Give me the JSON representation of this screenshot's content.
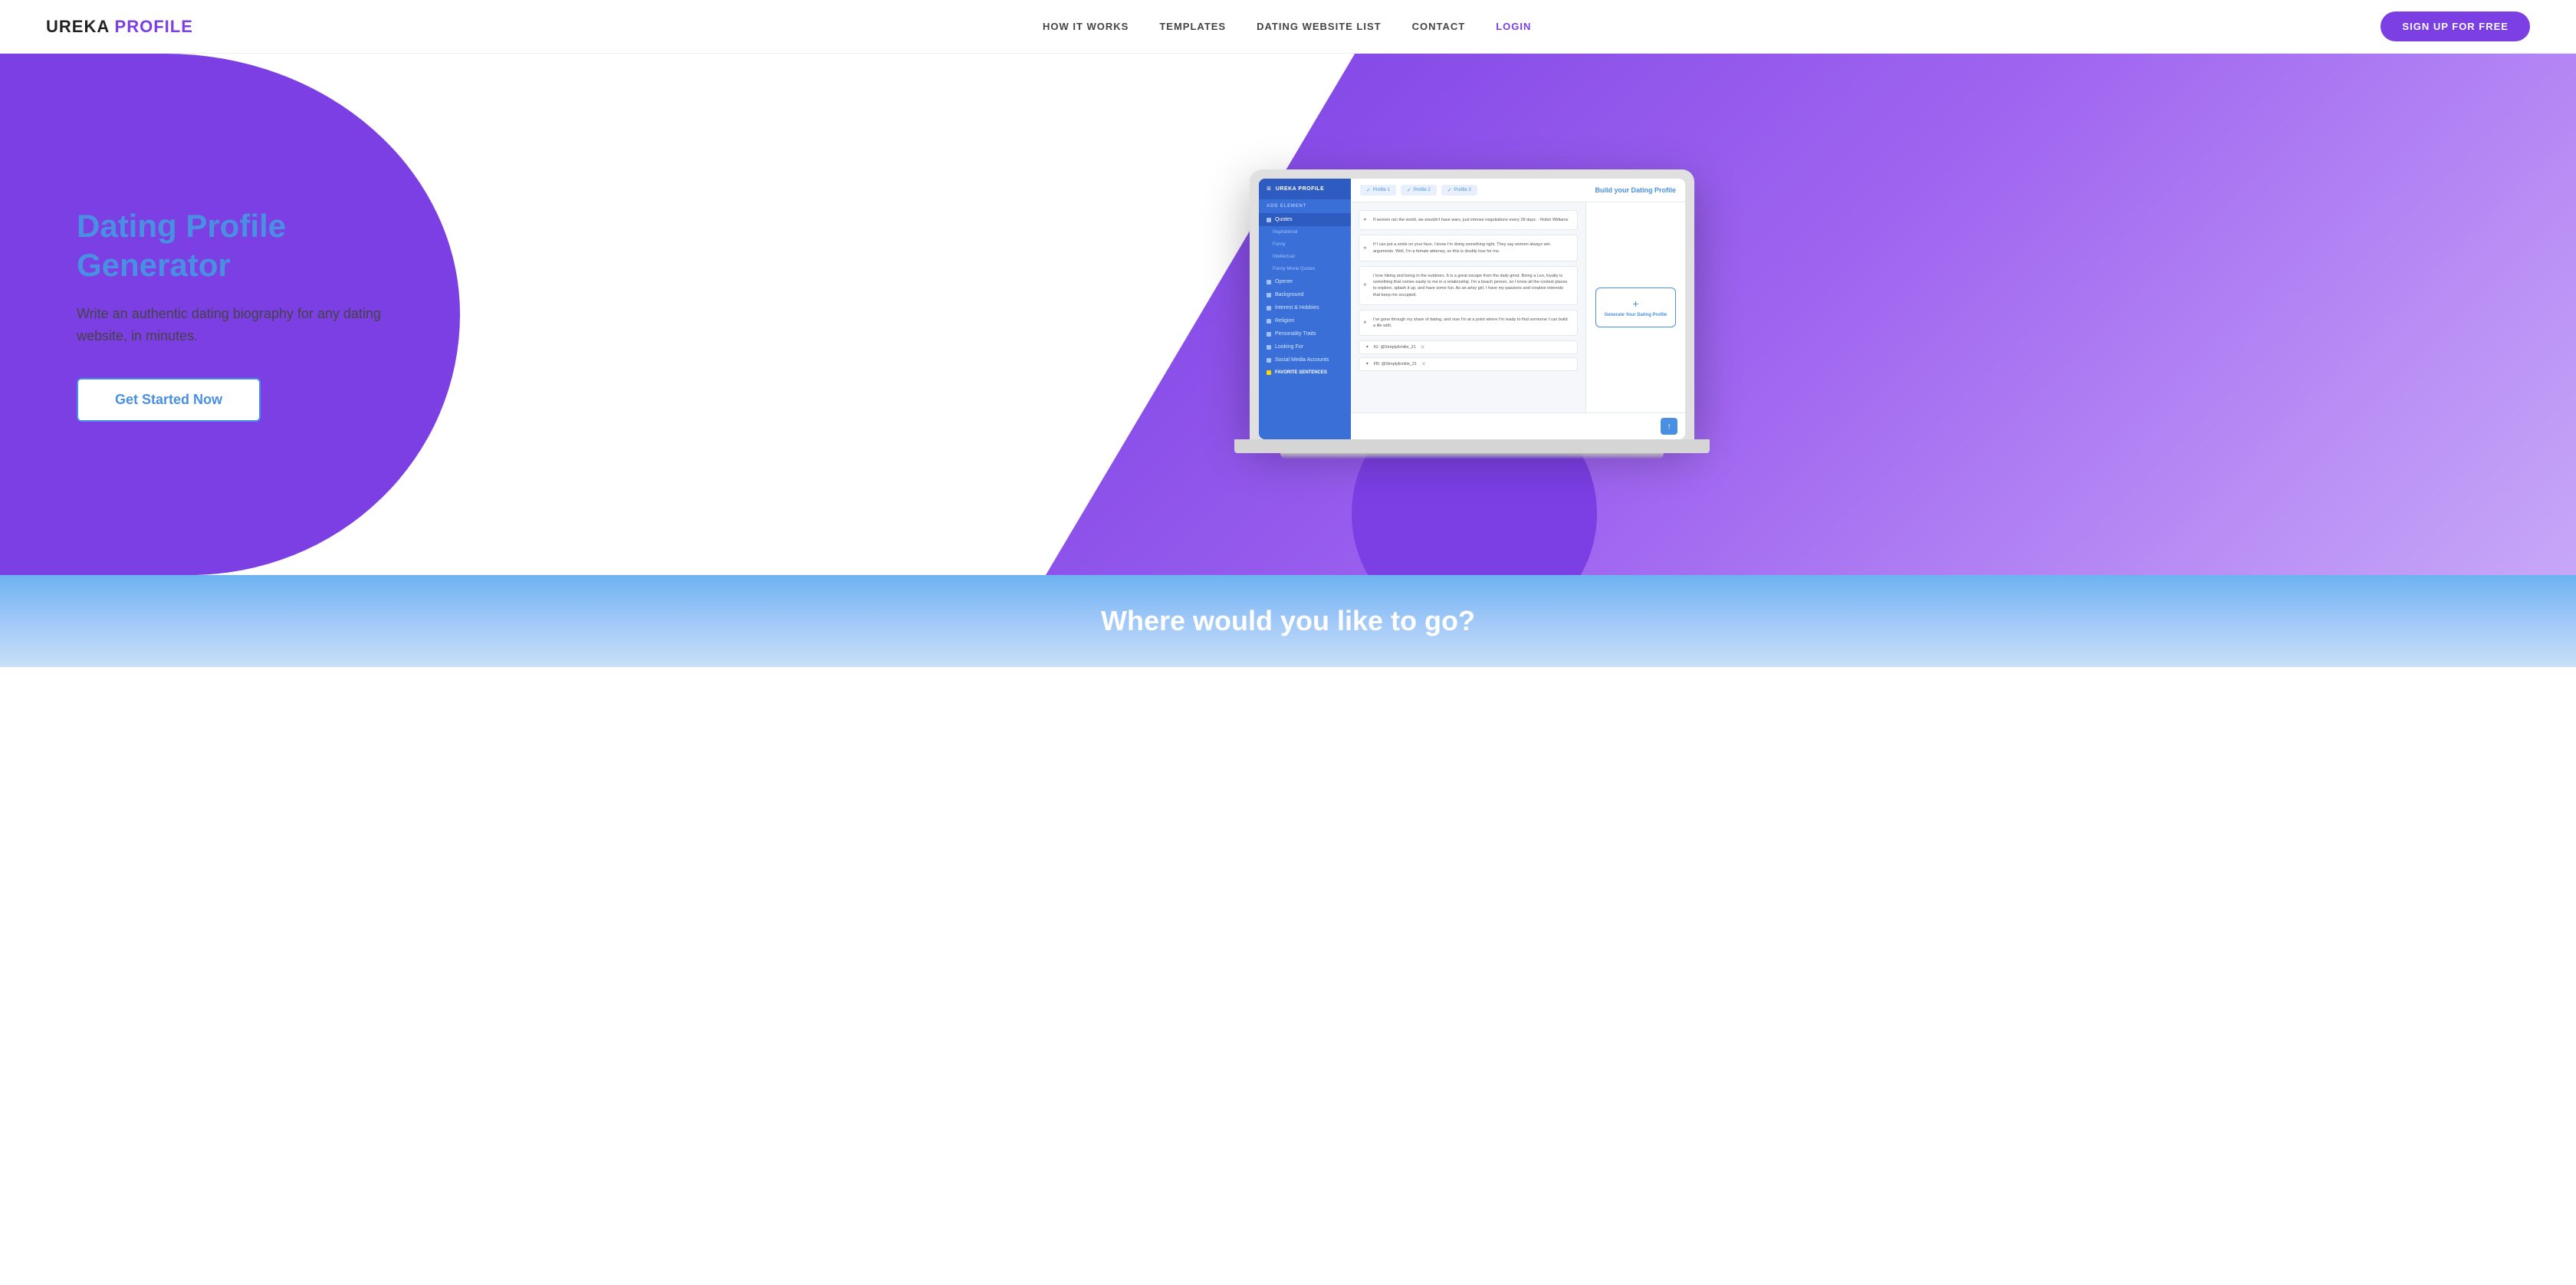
{
  "nav": {
    "logo_ureka": "UREKA",
    "logo_profile": "PROFILE",
    "links": [
      {
        "label": "HOW IT WORKS",
        "id": "how-it-works"
      },
      {
        "label": "TEMPLATES",
        "id": "templates"
      },
      {
        "label": "DATING WEBSITE LIST",
        "id": "dating-website-list"
      },
      {
        "label": "CONTACT",
        "id": "contact"
      },
      {
        "label": "LOGIN",
        "id": "login",
        "class": "login"
      }
    ],
    "signup_label": "SIGN UP FOR FREE"
  },
  "hero": {
    "title": "Dating Profile Generator",
    "subtitle": "Write an authentic dating biography for any dating website, in minutes.",
    "cta_label": "Get Started Now"
  },
  "app_mockup": {
    "sidebar_logo": "UREKA PROFILE",
    "section_label": "ADD ELEMENT",
    "items": [
      {
        "label": "Quotes",
        "icon": "quote"
      },
      {
        "label": "Inspirational",
        "sub": true
      },
      {
        "label": "Funny",
        "sub": true
      },
      {
        "label": "Intellectual",
        "sub": true
      },
      {
        "label": "Funny Movie Quotes",
        "sub": true
      },
      {
        "label": "Opener",
        "icon": "opener"
      },
      {
        "label": "Background",
        "icon": "background"
      },
      {
        "label": "Interest & Hobbies",
        "icon": "interest"
      },
      {
        "label": "Religion",
        "icon": "religion"
      },
      {
        "label": "Personality Traits",
        "icon": "personality"
      },
      {
        "label": "Looking For",
        "icon": "looking"
      },
      {
        "label": "Social Media Accounts",
        "icon": "social"
      },
      {
        "label": "FAVORITE SENTENCES",
        "icon": "star",
        "special": true
      }
    ],
    "top_title": "Build your Dating Profile",
    "tabs": [
      "Profile 1",
      "Profile 2",
      "Profile 3"
    ],
    "text_blocks": [
      "If women ran the world, we wouldn't have wars, just intense negotiations every 28 days. - Robin Williams",
      "If I can put a smile on your face, I know I'm doing something right. They say women always win arguments. Well, I'm a female attorney, so this is doubly true for me.",
      "I love hiking and being in the outdoors. It is a great escape from the daily grind. Being a Leo, loyalty is something that comes easily to me in a relationship. I'm a beach person, so I know all the coolest places to explore, splash it up, and have some fun. As an artsy girl, I have my passions and creative interests that keep me occupied.",
      "I've gone through my share of dating, and now I'm at a point where I'm ready to find someone I can build a life with."
    ],
    "social_rows": [
      "IG: @SimplyEmilie_21",
      "FB: @SimplyEmilie_21"
    ],
    "generate_label": "Generate Your Dating Profile"
  },
  "bottom": {
    "title": "Where would you like to go?"
  }
}
